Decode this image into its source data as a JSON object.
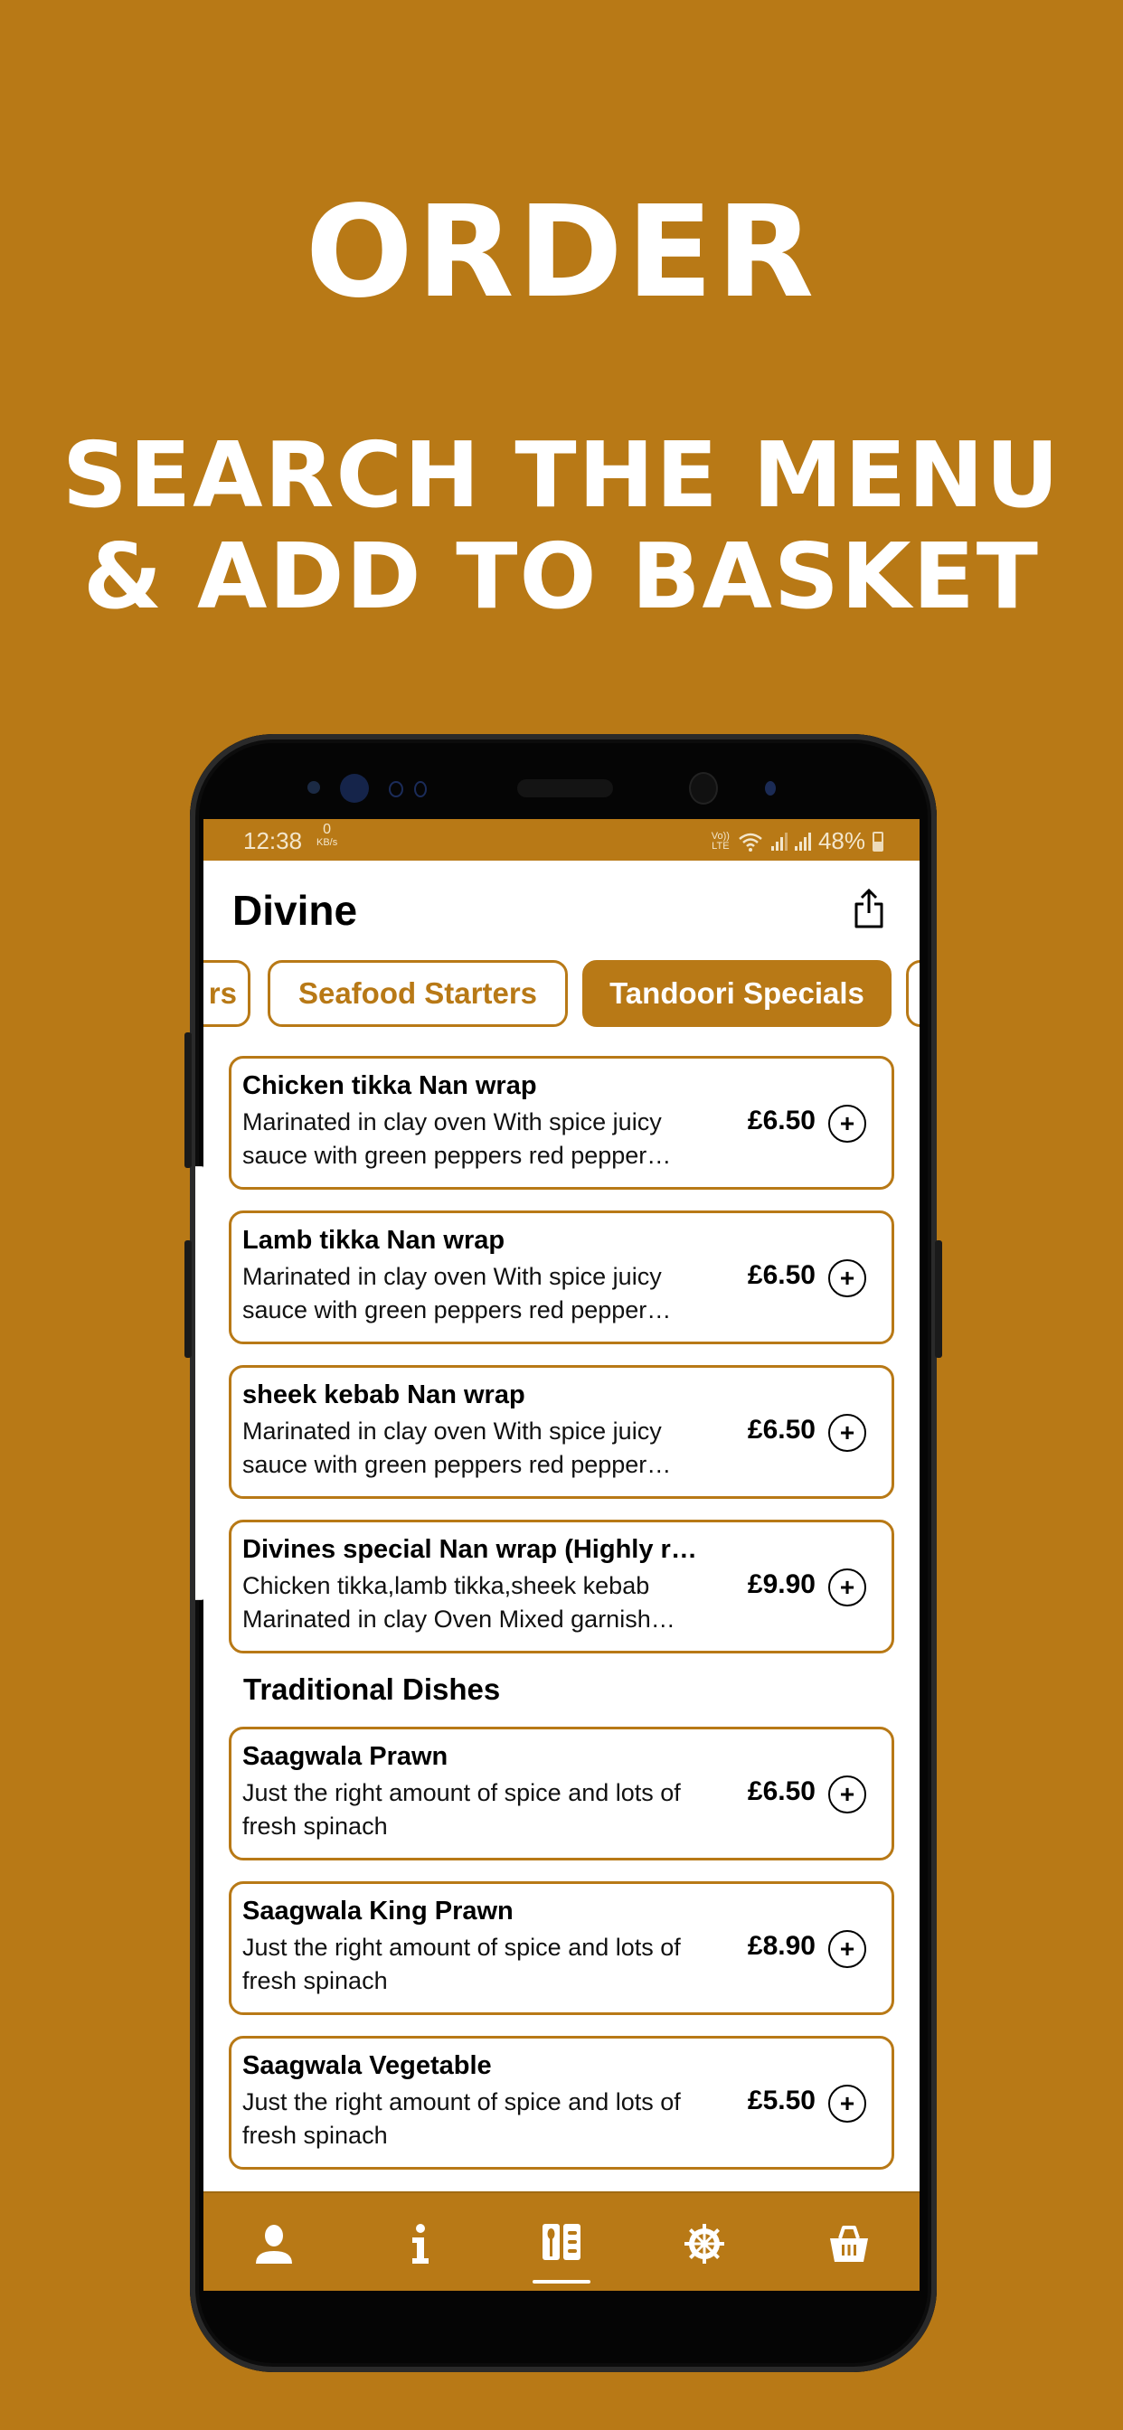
{
  "promo": {
    "headline": "ORDER",
    "subline_1": "SEARCH THE MENU",
    "subline_2": "& ADD TO BASKET"
  },
  "colors": {
    "brand": "#b87916",
    "card_border": "#b87916",
    "text": "#000000"
  },
  "status_bar": {
    "time": "12:38",
    "net_speed_value": "0",
    "net_speed_unit": "KB/s",
    "volte": "Vo))",
    "lte": "LTE",
    "battery": "48%"
  },
  "app_bar": {
    "title": "Divine",
    "share_icon": "share-icon"
  },
  "category_tabs": [
    {
      "label": "rs",
      "active": false
    },
    {
      "label": "Seafood Starters",
      "active": false
    },
    {
      "label": "Tandoori Specials",
      "active": true
    },
    {
      "label": "",
      "active": false
    }
  ],
  "menu": {
    "sections": [
      {
        "title": "",
        "items": [
          {
            "name": "Chicken tikka Nan wrap",
            "description": "Marinated in clay oven With spice juicy sauce with green peppers red pepper…",
            "price": "£6.50"
          },
          {
            "name": "Lamb tikka Nan wrap",
            "description": "Marinated in clay oven With spice juicy sauce with green peppers red pepper…",
            "price": "£6.50"
          },
          {
            "name": "sheek kebab Nan wrap",
            "description": "Marinated in clay oven With spice juicy sauce with green peppers red pepper…",
            "price": "£6.50"
          },
          {
            "name": "Divines special Nan wrap (Highly r…",
            "description": "Chicken tikka,lamb tikka,sheek kebab Marinated in clay Oven Mixed garnish…",
            "price": "£9.90"
          }
        ]
      },
      {
        "title": "Traditional Dishes",
        "items": [
          {
            "name": "Saagwala Prawn",
            "description": "Just the right amount of spice and lots of fresh spinach",
            "price": "£6.50"
          },
          {
            "name": "Saagwala King Prawn",
            "description": "Just the right amount of spice and lots of fresh spinach",
            "price": "£8.90"
          },
          {
            "name": "Saagwala Vegetable",
            "description": "Just the right amount of spice and lots of fresh spinach",
            "price": "£5.50"
          }
        ]
      }
    ],
    "add_label": "+"
  },
  "bottom_nav": [
    {
      "name": "account",
      "icon": "person-icon",
      "active": false
    },
    {
      "name": "info",
      "icon": "info-icon",
      "active": false
    },
    {
      "name": "menu",
      "icon": "menu-book-icon",
      "active": true
    },
    {
      "name": "settings",
      "icon": "gear-icon",
      "active": false
    },
    {
      "name": "basket",
      "icon": "basket-icon",
      "active": false
    }
  ]
}
